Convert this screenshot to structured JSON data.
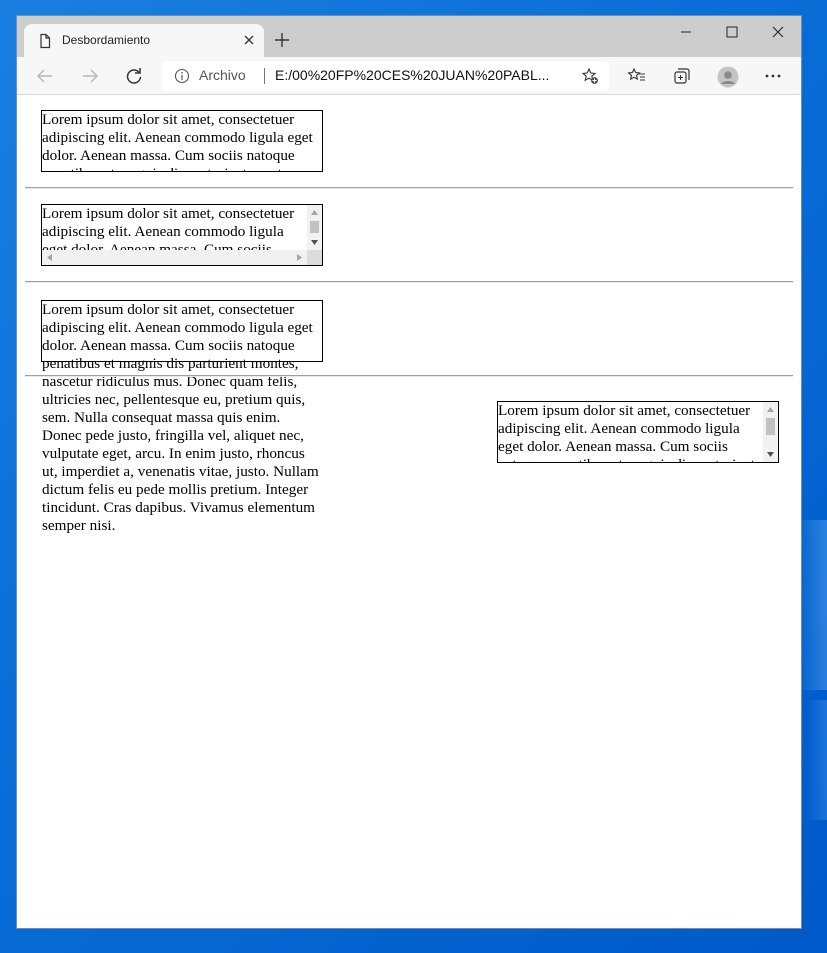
{
  "browser": {
    "tab_title": "Desbordamiento",
    "address_scheme": "Archivo",
    "address_url": "E:/00%20FP%20CES%20JUAN%20PABL..."
  },
  "content": {
    "lorem": "Lorem ipsum dolor sit amet, consectetuer adipiscing elit. Aenean commodo ligula eget dolor. Aenean massa. Cum sociis natoque penatibus et magnis dis parturient montes, nascetur ridiculus mus. Donec quam felis, ultricies nec, pellentesque eu, pretium quis, sem. Nulla consequat massa quis enim. Donec pede justo, fringilla vel, aliquet nec, vulputate eget, arcu. In enim justo, rhoncus ut, imperdiet a, venenatis vitae, justo. Nullam dictum felis eu pede mollis pretium. Integer tincidunt. Cras dapibus. Vivamus elementum semper nisi."
  },
  "colors": {
    "tabstrip": "#cdcdcd",
    "toolbar": "#f7f7f7",
    "desktop": "#0a6fd8"
  },
  "icons": [
    "page-icon",
    "close-icon",
    "plus-icon",
    "minimize-icon",
    "maximize-icon",
    "window-close-icon",
    "back-arrow-icon",
    "forward-arrow-icon",
    "reload-icon",
    "info-icon",
    "add-favorite-icon",
    "favorites-icon",
    "collections-icon",
    "profile-icon",
    "more-icon"
  ]
}
